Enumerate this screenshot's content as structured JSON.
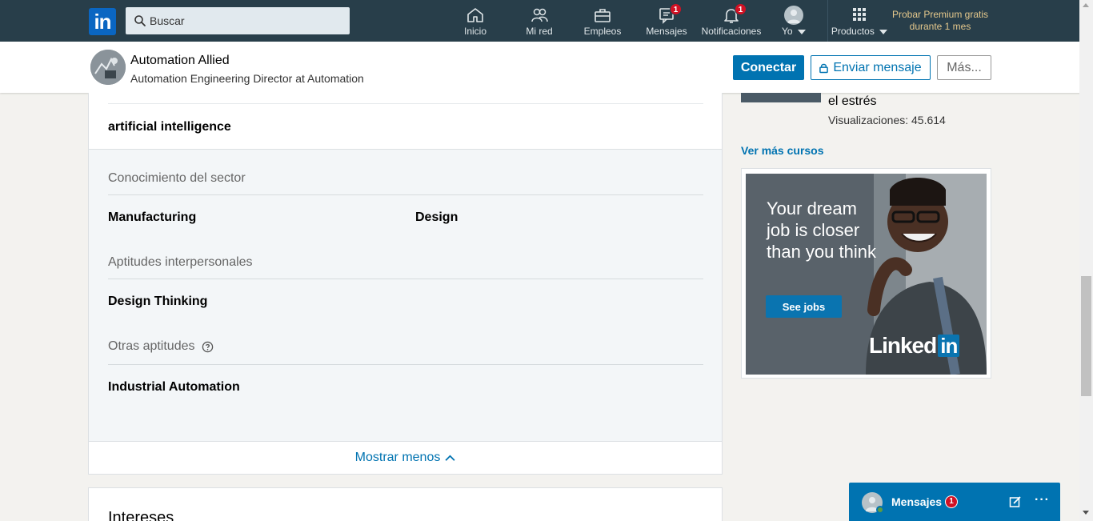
{
  "nav": {
    "logo": "in",
    "search_placeholder": "Buscar",
    "items": [
      {
        "label": "Inicio",
        "icon": "home-icon"
      },
      {
        "label": "Mi red",
        "icon": "network-icon"
      },
      {
        "label": "Empleos",
        "icon": "briefcase-icon"
      },
      {
        "label": "Mensajes",
        "icon": "messages-icon",
        "badge": "1"
      },
      {
        "label": "Notificaciones",
        "icon": "bell-icon",
        "badge": "1"
      },
      {
        "label": "Yo",
        "icon": "avatar-icon"
      },
      {
        "label": "Productos",
        "icon": "grid-icon"
      }
    ],
    "premium_line1": "Probar Premium gratis",
    "premium_line2": "durante 1 mes"
  },
  "profile": {
    "name": "Automation Allied",
    "headline": "Automation Engineering Director at Automation",
    "connect_label": "Conectar",
    "message_label": "Enviar mensaje",
    "more_label": "Más..."
  },
  "skills": {
    "top_skill": "artificial intelligence",
    "categories": [
      {
        "title": "Conocimiento del sector",
        "items": [
          "Manufacturing",
          "Design"
        ]
      },
      {
        "title": "Aptitudes interpersonales",
        "items": [
          "Design Thinking"
        ]
      },
      {
        "title": "Otras aptitudes",
        "items": [
          "Industrial Automation"
        ]
      }
    ],
    "show_less_label": "Mostrar menos"
  },
  "interests": {
    "title": "Intereses"
  },
  "sidebar": {
    "course_title_tail": "el estrés",
    "course_views": "Visualizaciones: 45.614",
    "more_courses_label": "Ver más cursos",
    "ad": {
      "headline": "Your dream job is closer than you think",
      "cta": "See jobs",
      "brand_a": "Linked",
      "brand_b": "in"
    }
  },
  "messaging": {
    "label": "Mensajes",
    "badge": "1",
    "dots": "···"
  },
  "colors": {
    "nav_bg": "#283e4a",
    "accent": "#0073b1",
    "badge": "#d11124",
    "premium": "#e5c88c"
  }
}
